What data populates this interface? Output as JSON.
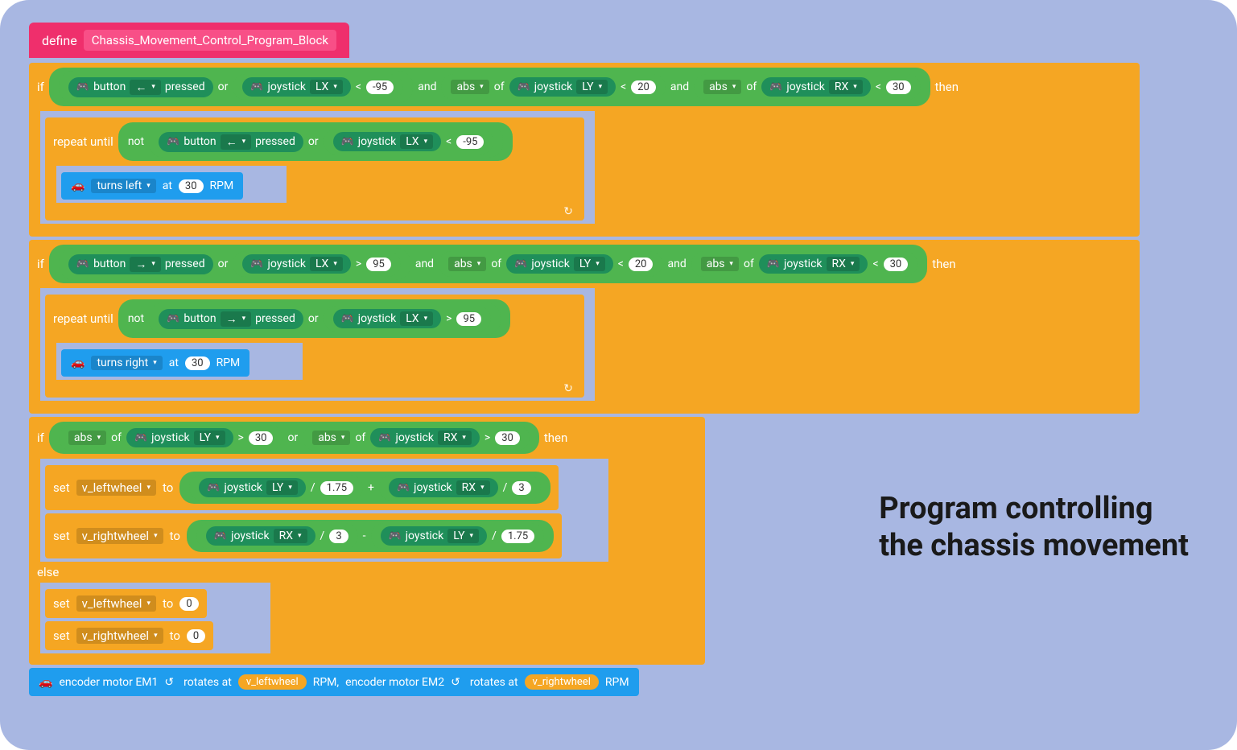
{
  "define": {
    "keyword": "define",
    "name": "Chassis_Movement_Control_Program_Block"
  },
  "labels": {
    "button": "button",
    "pressed": "pressed",
    "joystick": "joystick",
    "or": "or",
    "and": "and",
    "abs": "abs",
    "of": "of",
    "then": "then",
    "if": "if",
    "repeat_until": "repeat until",
    "not": "not",
    "set": "set",
    "to": "to",
    "else": "else",
    "turns_left": "turns left",
    "turns_right": "turns right",
    "at": "at",
    "rpm": "RPM",
    "encoder1": "encoder motor EM1",
    "encoder2": "encoder motor EM2",
    "rotates_at": "rotates at",
    "comma_sep": "RPM,"
  },
  "arrows": {
    "left": "←",
    "right": "→"
  },
  "axes": {
    "lx": "LX",
    "ly": "LY",
    "rx": "RX"
  },
  "ops": {
    "lt": "<",
    "gt": ">",
    "div": "/",
    "plus": "+",
    "minus": "-"
  },
  "vals": {
    "n95": "-95",
    "p95": "95",
    "20": "20",
    "30": "30",
    "175": "1.75",
    "3": "3",
    "0": "0"
  },
  "vars": {
    "vl": "v_leftwheel",
    "vr": "v_rightwheel"
  },
  "sidetext_l1": "Program controlling",
  "sidetext_l2": "the chassis movement"
}
